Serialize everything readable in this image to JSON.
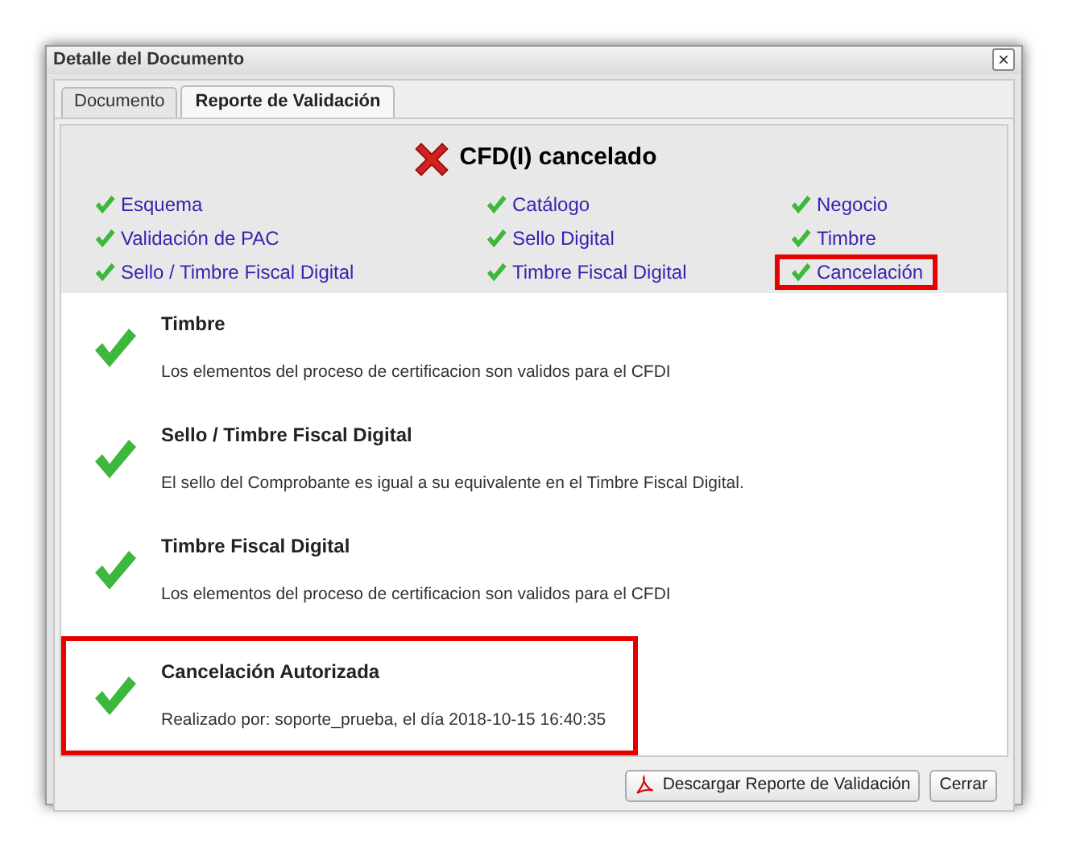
{
  "window": {
    "title": "Detalle del Documento",
    "close": "×"
  },
  "tabs": [
    {
      "label": "Documento",
      "selected": false
    },
    {
      "label": "Reporte de Validación",
      "selected": true
    }
  ],
  "status": {
    "title": "CFD(I) cancelado"
  },
  "checks": [
    {
      "label": "Esquema",
      "highlighted": false
    },
    {
      "label": "Catálogo",
      "highlighted": false
    },
    {
      "label": "Negocio",
      "highlighted": false
    },
    {
      "label": "Validación de PAC",
      "highlighted": false
    },
    {
      "label": "Sello Digital",
      "highlighted": false
    },
    {
      "label": "Timbre",
      "highlighted": false
    },
    {
      "label": "Sello / Timbre Fiscal Digital",
      "highlighted": false
    },
    {
      "label": "Timbre Fiscal Digital",
      "highlighted": false
    },
    {
      "label": "Cancelación",
      "highlighted": true
    }
  ],
  "results": [
    {
      "title": "Timbre",
      "text": "Los elementos del proceso de certificacion son validos para el CFDI",
      "highlighted": false
    },
    {
      "title": "Sello / Timbre Fiscal Digital",
      "text": "El sello del Comprobante es igual a su equivalente en el Timbre Fiscal Digital.",
      "highlighted": false
    },
    {
      "title": "Timbre Fiscal Digital",
      "text": "Los elementos del proceso de certificacion son validos para el CFDI",
      "highlighted": false
    },
    {
      "title": "Cancelación Autorizada",
      "text": "Realizado por: soporte_prueba, el día 2018-10-15 16:40:35",
      "highlighted": true
    }
  ],
  "buttons": [
    {
      "label": "Descargar Reporte de Validación",
      "kind": "pdf"
    },
    {
      "label": "Cerrar",
      "kind": "plain"
    }
  ]
}
